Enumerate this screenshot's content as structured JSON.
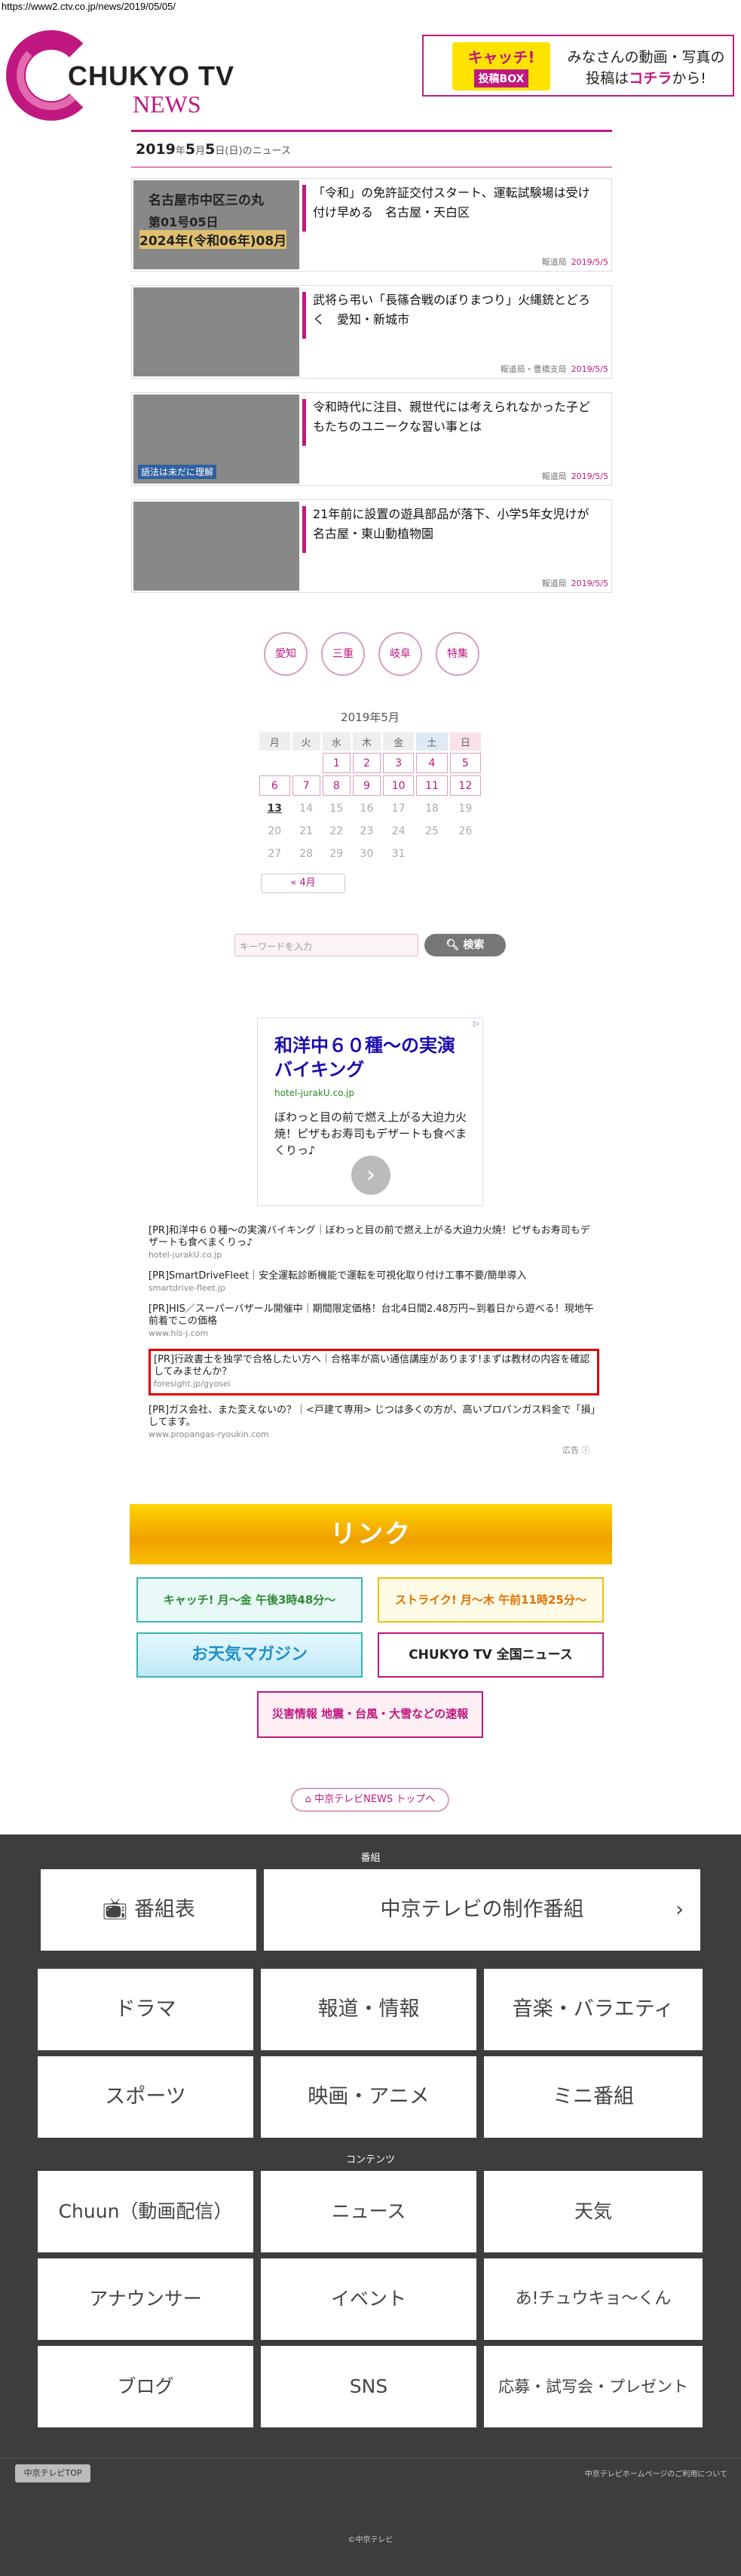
{
  "url": "https://www2.ctv.co.jp/news/2019/05/05/",
  "logo": {
    "line1": "CHUKYO TV",
    "line2": "NEWS"
  },
  "banner": {
    "logo_top": "キャッチ!",
    "logo_bottom": "投稿BOX",
    "text1": "みなさんの動画・写真の",
    "text2_pre": "投稿は",
    "text2_em": "コチラ",
    "text2_post": "から!"
  },
  "date": {
    "year": "2019",
    "y": "年",
    "month": "5",
    "m": "月",
    "day": "5",
    "d": "日",
    "dow": "(日)",
    "suffix": "のニュース"
  },
  "news": [
    {
      "title": "「令和」の免許証交付スタート、運転試験場は受け付け早める　名古屋・天白区",
      "source": "報道局",
      "date": "2019/5/5"
    },
    {
      "title": "武将ら弔い「長篠合戦のぼりまつり」火縄銃とどろく　愛知・新城市",
      "source": "報道局・豊橋支局",
      "date": "2019/5/5"
    },
    {
      "title": "令和時代に注目、親世代には考えられなかった子どもたちのユニークな習い事とは",
      "source": "報道局",
      "date": "2019/5/5"
    },
    {
      "title": "21年前に設置の遊具部品が落下、小学5年女児けが　名古屋・東山動植物園",
      "source": "報道局",
      "date": "2019/5/5"
    }
  ],
  "thumb_texts": {
    "t1": "名古屋市中区三の丸",
    "t1b": "第01号05日",
    "t1c": "2024年(令和06年)08月",
    "t3": "語法は未だに理解"
  },
  "categories": [
    "愛知",
    "三重",
    "岐阜",
    "特集"
  ],
  "calendar": {
    "title": "2019年5月",
    "headers": [
      "月",
      "火",
      "水",
      "木",
      "金",
      "土",
      "日"
    ],
    "rows": [
      [
        "",
        "",
        "1",
        "2",
        "3",
        "4",
        "5"
      ],
      [
        "6",
        "7",
        "8",
        "9",
        "10",
        "11",
        "12"
      ],
      [
        "13",
        "14",
        "15",
        "16",
        "17",
        "18",
        "19"
      ],
      [
        "20",
        "21",
        "22",
        "23",
        "24",
        "25",
        "26"
      ],
      [
        "27",
        "28",
        "29",
        "30",
        "31",
        "",
        ""
      ]
    ],
    "prev": "« 4月"
  },
  "search": {
    "placeholder": "キーワードを入力",
    "button": "検索"
  },
  "ad": {
    "headline": "和洋中６０種～の実演バイキング",
    "url": "hotel-jurakU.co.jp",
    "desc": "ぼわっと目の前で燃え上がる大迫力火焼！ピザもお寿司もデザートも食べまくりっ♪",
    "arrow": "›"
  },
  "pr_ads": [
    {
      "text": "[PR]和洋中６０種～の実演バイキング｜ぼわっと目の前で燃え上がる大迫力火焼！ピザもお寿司もデザートも食べまくりっ♪",
      "site": "hotel-jurakU.co.jp"
    },
    {
      "text": "[PR]SmartDriveFleet｜安全運転診断機能で運転を可視化取り付け工事不要/簡単導入",
      "site": "smartdrive-fleet.jp"
    },
    {
      "text": "[PR]HIS／スーパーバザール開催中｜期間限定価格！台北4日間2.48万円~到着日から遊べる！現地午前着でこの価格",
      "site": "www.his-j.com"
    },
    {
      "text": "[PR]行政書士を独学で合格したい方へ｜合格率が高い通信講座があります!まずは教材の内容を確認してみませんか？",
      "site": "foresight.jp/gyosei"
    },
    {
      "text": "[PR]ガス会社、また変えないの？｜<戸建て専用> じつは多くの方が、高いプロパンガス料金で「損」してます。",
      "site": "www.propangas-ryoukin.com"
    }
  ],
  "ad_label": "広告 ⓘ",
  "links": {
    "heading": "リンク",
    "catch": "キャッチ! 月～金 午後3時48分～",
    "stryd": "ストライク! 月～木 午前11時25分～",
    "tenki": "お天気マガジン",
    "ctv": "CHUKYO TV 全国ニュース",
    "saigai": "災害情報 地震・台風・大雪などの速報"
  },
  "top_button": "中京テレビNEWS トップへ",
  "footer": {
    "sec1": "番組",
    "guide": "番組表",
    "own": "中京テレビの制作番組",
    "programs": [
      "ドラマ",
      "報道・情報",
      "音楽・バラエティ",
      "スポーツ",
      "映画・アニメ",
      "ミニ番組"
    ],
    "sec2": "コンテンツ",
    "contents": [
      "Chuun（動画配信）",
      "ニュース",
      "天気",
      "アナウンサー",
      "イベント",
      "あ!チュウキョ～くん",
      "ブログ",
      "SNS",
      "応募・試写会・プレゼント"
    ],
    "top_link": "中京テレビTOP",
    "right_link": "中京テレビホームページのご利用について",
    "copyright": "©中京テレビ"
  }
}
